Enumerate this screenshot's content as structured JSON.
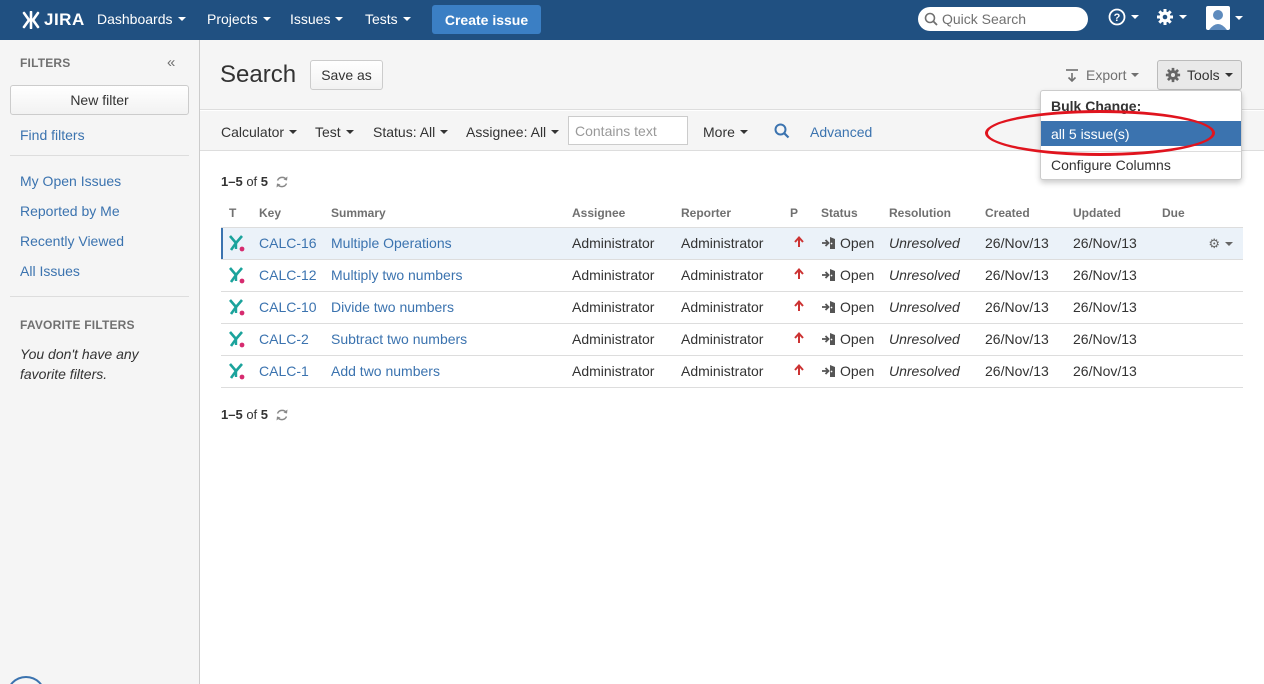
{
  "nav": {
    "logo": "JIRA",
    "items": [
      "Dashboards",
      "Projects",
      "Issues",
      "Tests"
    ],
    "create_label": "Create issue",
    "search_placeholder": "Quick Search"
  },
  "sidebar": {
    "heading": "FILTERS",
    "new_filter": "New filter",
    "find_filters": "Find filters",
    "links": [
      "My Open Issues",
      "Reported by Me",
      "Recently Viewed",
      "All Issues"
    ],
    "fav_heading": "FAVORITE FILTERS",
    "fav_empty": "You don't have any favorite filters."
  },
  "header": {
    "title": "Search",
    "save_as": "Save as",
    "export": "Export",
    "tools": "Tools"
  },
  "filters": {
    "project": "Calculator",
    "type": "Test",
    "status": "Status: All",
    "assignee": "Assignee: All",
    "contains_placeholder": "Contains text",
    "more": "More",
    "advanced": "Advanced"
  },
  "results": {
    "range": "1–5",
    "of": "of",
    "total": "5",
    "columns": [
      "T",
      "Key",
      "Summary",
      "Assignee",
      "Reporter",
      "P",
      "Status",
      "Resolution",
      "Created",
      "Updated",
      "Due"
    ],
    "rows": [
      {
        "key": "CALC-16",
        "summary": "Multiple Operations",
        "assignee": "Administrator",
        "reporter": "Administrator",
        "status": "Open",
        "resolution": "Unresolved",
        "created": "26/Nov/13",
        "updated": "26/Nov/13",
        "due": ""
      },
      {
        "key": "CALC-12",
        "summary": "Multiply two numbers",
        "assignee": "Administrator",
        "reporter": "Administrator",
        "status": "Open",
        "resolution": "Unresolved",
        "created": "26/Nov/13",
        "updated": "26/Nov/13",
        "due": ""
      },
      {
        "key": "CALC-10",
        "summary": "Divide two numbers",
        "assignee": "Administrator",
        "reporter": "Administrator",
        "status": "Open",
        "resolution": "Unresolved",
        "created": "26/Nov/13",
        "updated": "26/Nov/13",
        "due": ""
      },
      {
        "key": "CALC-2",
        "summary": "Subtract two numbers",
        "assignee": "Administrator",
        "reporter": "Administrator",
        "status": "Open",
        "resolution": "Unresolved",
        "created": "26/Nov/13",
        "updated": "26/Nov/13",
        "due": ""
      },
      {
        "key": "CALC-1",
        "summary": "Add two numbers",
        "assignee": "Administrator",
        "reporter": "Administrator",
        "status": "Open",
        "resolution": "Unresolved",
        "created": "26/Nov/13",
        "updated": "26/Nov/13",
        "due": ""
      }
    ]
  },
  "tools_menu": {
    "heading": "Bulk Change:",
    "all_issues": "all 5 issue(s)",
    "configure": "Configure Columns"
  },
  "colors": {
    "nav_bg": "#205081",
    "create_button": "#3b7fc4",
    "link": "#3b73af",
    "highlight_ellipse": "#e0141e",
    "priority": "#cc3333",
    "issue_type": "#1ba39c"
  },
  "icons": [
    "jira-logo-icon",
    "search-icon",
    "help-icon",
    "gear-icon",
    "user-avatar-icon",
    "collapse-icon",
    "refresh-icon",
    "issue-type-icon",
    "priority-major-icon",
    "status-open-icon",
    "export-icon",
    "row-actions-icon"
  ]
}
